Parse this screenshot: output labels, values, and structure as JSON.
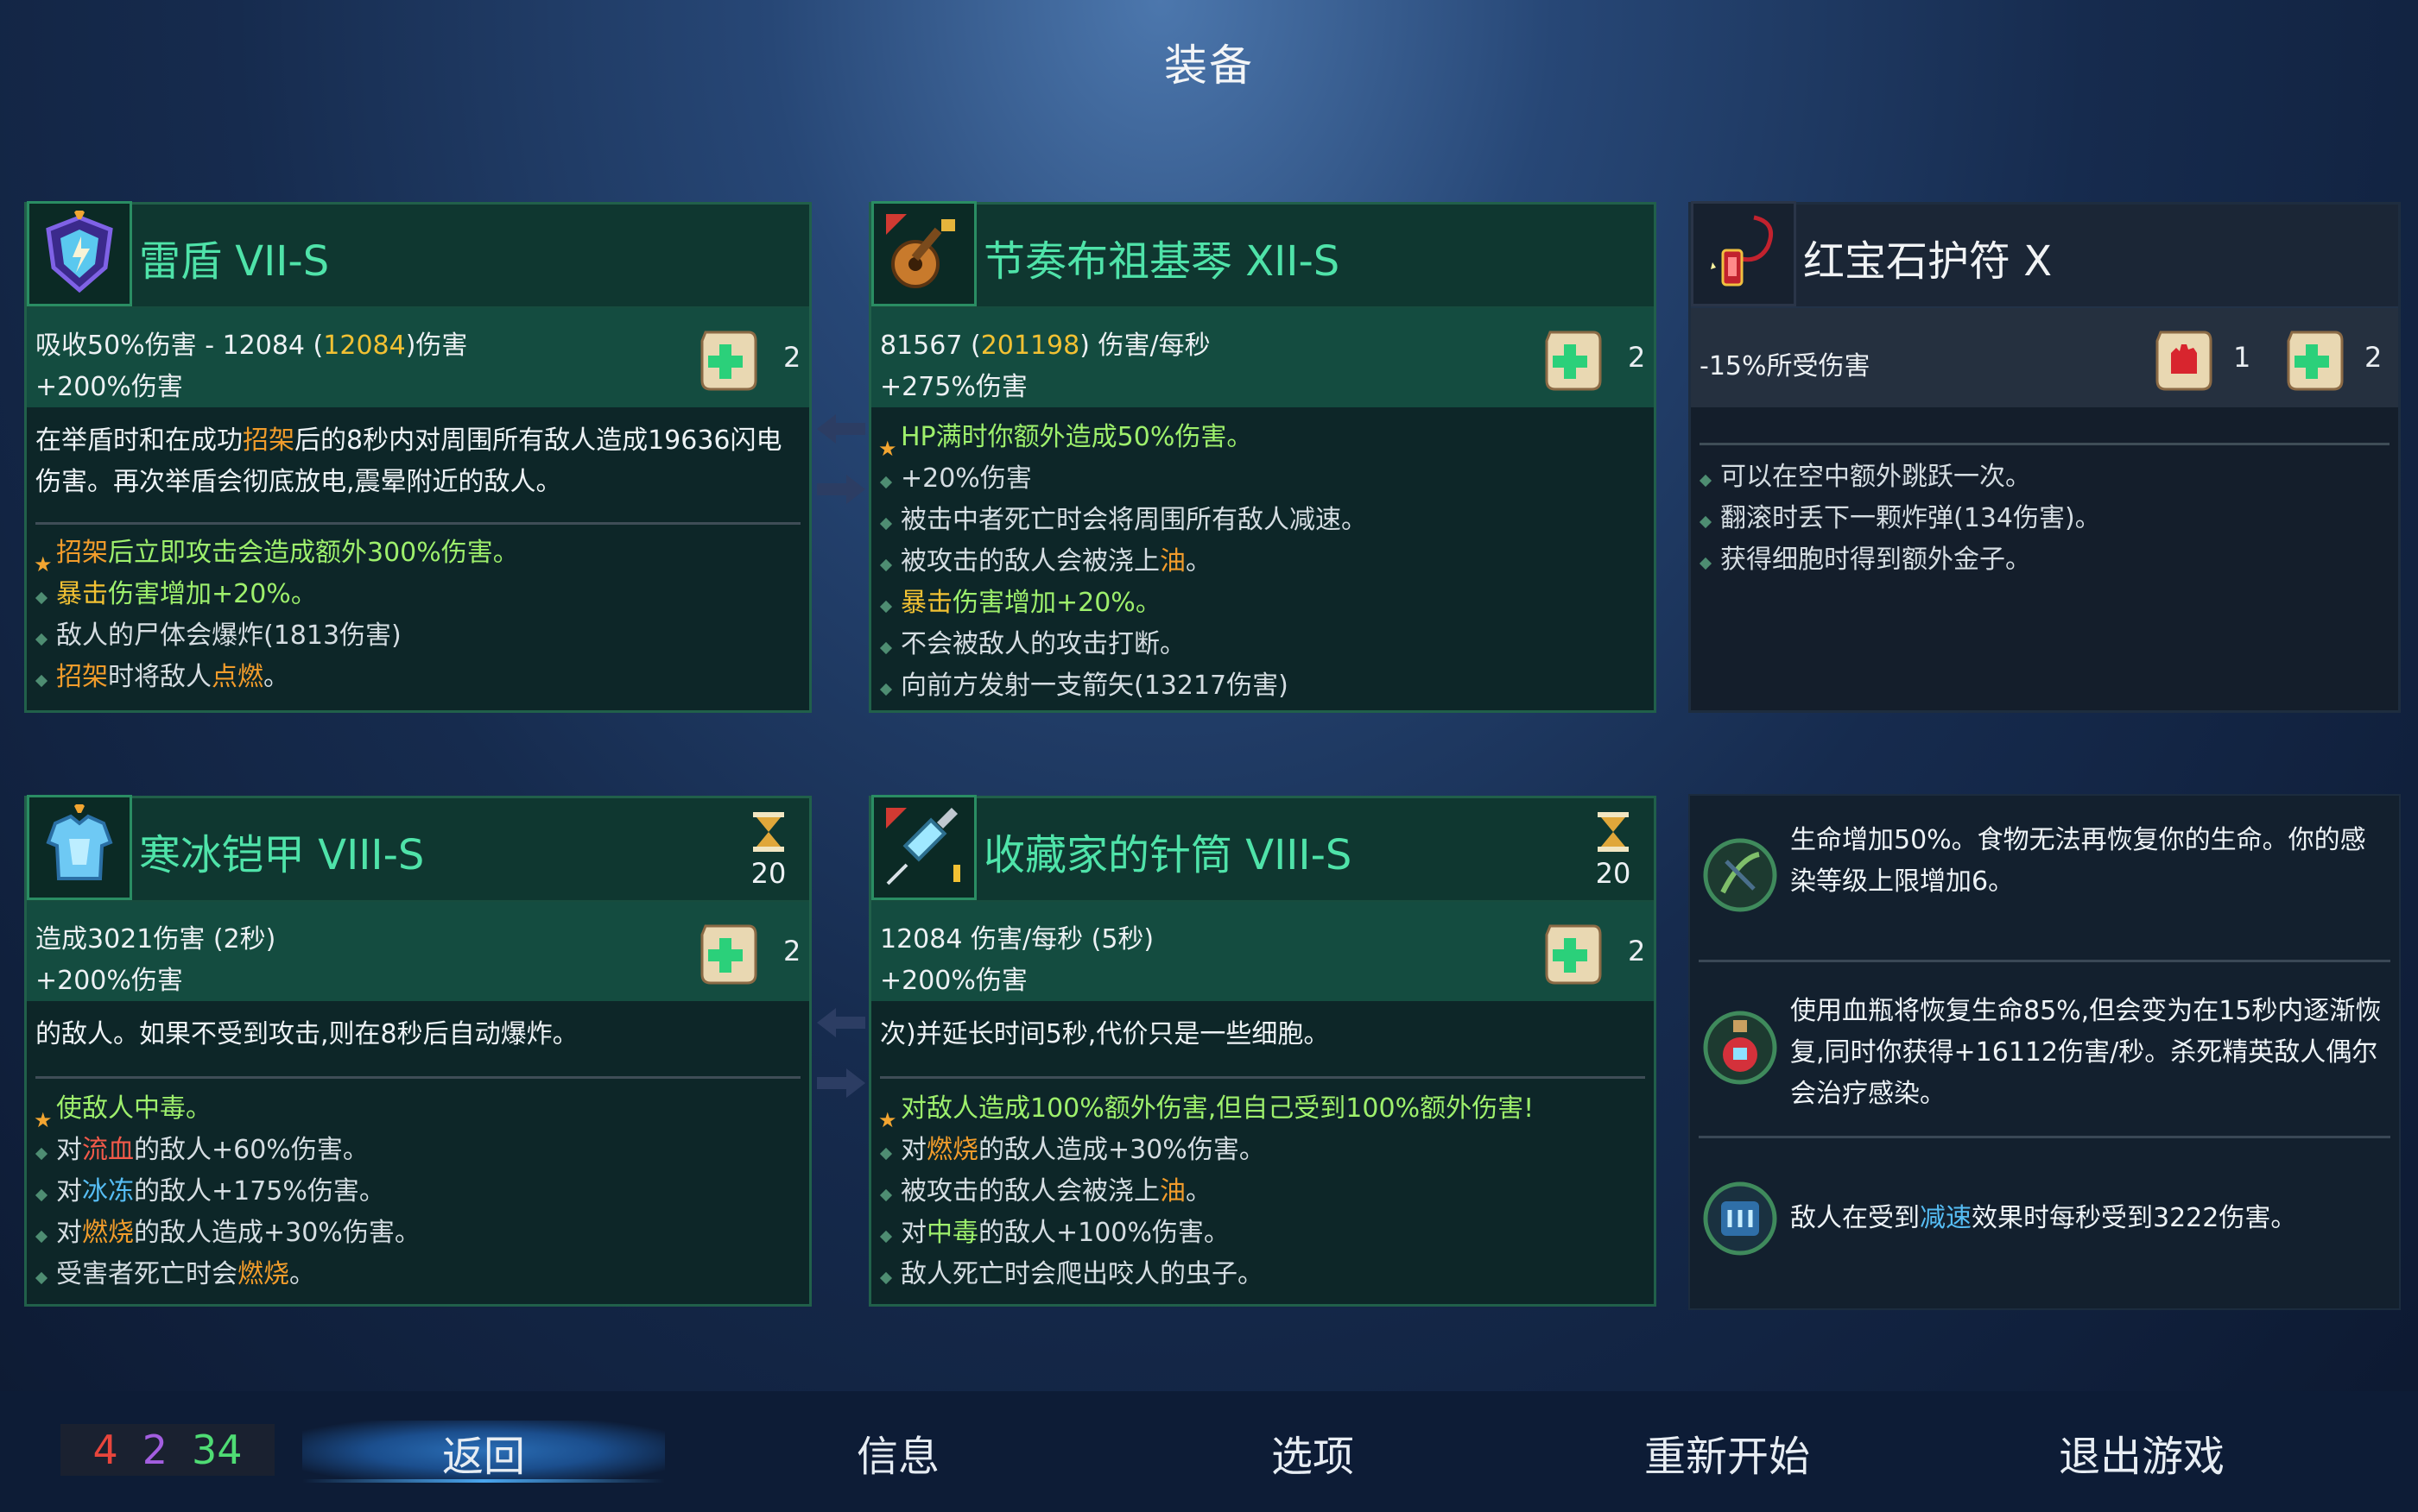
{
  "title": "装备",
  "cards": {
    "c1": {
      "name": "雷盾 VII-S",
      "stat1": {
        "a": "吸收50%伤害 - 12084 (",
        "b": "12084",
        "c": ")伤害"
      },
      "stat2": "+200%伤害",
      "scroll_count": "2",
      "desc": [
        {
          "t": "在举盾时和在成功",
          "c": ""
        },
        {
          "t": "招架",
          "c": "orange"
        },
        {
          "t": "后的8秒内对周围所有敌人造成19636闪电伤害。再次举盾会彻底放电,震晕附近的敌人。",
          "c": ""
        }
      ],
      "affixes": [
        {
          "bullet": "star",
          "parts": [
            {
              "t": "招架",
              "c": "orange"
            },
            {
              "t": "后立即攻击会造成额外300%伤害。",
              "c": "green"
            }
          ]
        },
        {
          "bullet": "dot",
          "parts": [
            {
              "t": "暴击",
              "c": "yellow"
            },
            {
              "t": "伤害增加+20%。",
              "c": "green"
            }
          ]
        },
        {
          "bullet": "dot",
          "parts": [
            {
              "t": "敌人的尸体会爆炸(1813伤害)",
              "c": ""
            }
          ]
        },
        {
          "bullet": "dot",
          "parts": [
            {
              "t": "招架",
              "c": "orange"
            },
            {
              "t": "时将敌人",
              "c": ""
            },
            {
              "t": "点燃",
              "c": "orange"
            },
            {
              "t": "。",
              "c": ""
            }
          ]
        }
      ]
    },
    "c2": {
      "name": "节奏布祖基琴 XII-S",
      "stat1": {
        "a": "81567 (",
        "b": "201198",
        "c": ") 伤害/每秒"
      },
      "stat2": "+275%伤害",
      "scroll_count": "2",
      "affixes": [
        {
          "bullet": "star",
          "parts": [
            {
              "t": "HP满时你额外造成50%伤害。",
              "c": "green"
            }
          ]
        },
        {
          "bullet": "dot",
          "parts": [
            {
              "t": "+20%伤害",
              "c": ""
            }
          ]
        },
        {
          "bullet": "dot",
          "parts": [
            {
              "t": "被击中者死亡时会将周围所有敌人减速。",
              "c": ""
            }
          ]
        },
        {
          "bullet": "dot",
          "parts": [
            {
              "t": "被攻击的敌人会被浇上",
              "c": ""
            },
            {
              "t": "油",
              "c": "orange"
            },
            {
              "t": "。",
              "c": ""
            }
          ]
        },
        {
          "bullet": "dot",
          "parts": [
            {
              "t": "暴击",
              "c": "yellow"
            },
            {
              "t": "伤害增加+20%。",
              "c": "green"
            }
          ]
        },
        {
          "bullet": "dot",
          "parts": [
            {
              "t": "不会被敌人的攻击打断。",
              "c": ""
            }
          ]
        },
        {
          "bullet": "dot",
          "parts": [
            {
              "t": "向前方发射一支箭矢(13217伤害)",
              "c": ""
            }
          ]
        }
      ]
    },
    "c3": {
      "name": "红宝石护符 X",
      "stat1": "-15%所受伤害",
      "scroll1_count": "1",
      "scroll2_count": "2",
      "affixes": [
        {
          "bullet": "dot",
          "parts": [
            {
              "t": "可以在空中额外跳跃一次。",
              "c": ""
            }
          ]
        },
        {
          "bullet": "dot",
          "parts": [
            {
              "t": "翻滚时丢下一颗炸弹(134伤害)。",
              "c": ""
            }
          ]
        },
        {
          "bullet": "dot",
          "parts": [
            {
              "t": "获得细胞时得到额外金子。",
              "c": ""
            }
          ]
        }
      ]
    },
    "c4": {
      "name": "寒冰铠甲 VIII-S",
      "cooldown": "20",
      "stat1": "造成3021伤害 (2秒)",
      "stat2": "+200%伤害",
      "scroll_count": "2",
      "desc": [
        {
          "t": "的敌人。如果不受到攻击,则在8秒后自动爆炸。",
          "c": ""
        }
      ],
      "affixes": [
        {
          "bullet": "star",
          "parts": [
            {
              "t": "使敌人",
              "c": "green"
            },
            {
              "t": "中毒",
              "c": "green"
            },
            {
              "t": "。",
              "c": "green"
            }
          ]
        },
        {
          "bullet": "dot",
          "parts": [
            {
              "t": "对",
              "c": ""
            },
            {
              "t": "流血",
              "c": "red"
            },
            {
              "t": "的敌人+60%伤害。",
              "c": ""
            }
          ]
        },
        {
          "bullet": "dot",
          "parts": [
            {
              "t": "对",
              "c": ""
            },
            {
              "t": "冰冻",
              "c": "blue"
            },
            {
              "t": "的敌人+175%伤害。",
              "c": ""
            }
          ]
        },
        {
          "bullet": "dot",
          "parts": [
            {
              "t": "对",
              "c": ""
            },
            {
              "t": "燃烧",
              "c": "orange"
            },
            {
              "t": "的敌人造成+30%伤害。",
              "c": ""
            }
          ]
        },
        {
          "bullet": "dot",
          "parts": [
            {
              "t": "受害者死亡时会",
              "c": ""
            },
            {
              "t": "燃烧",
              "c": "orange"
            },
            {
              "t": "。",
              "c": ""
            }
          ]
        }
      ]
    },
    "c5": {
      "name": "收藏家的针筒 VIII-S",
      "cooldown": "20",
      "stat1": "12084 伤害/每秒 (5秒)",
      "stat2": "+200%伤害",
      "scroll_count": "2",
      "desc": [
        {
          "t": "次)并延长时间5秒,代价只是一些细胞。",
          "c": ""
        }
      ],
      "affixes": [
        {
          "bullet": "star2",
          "parts": [
            {
              "t": "对敌人造成100%额外伤害,但自己受到100%额外伤害!",
              "c": "green"
            }
          ]
        },
        {
          "bullet": "dot",
          "parts": [
            {
              "t": "对",
              "c": ""
            },
            {
              "t": "燃烧",
              "c": "orange"
            },
            {
              "t": "的敌人造成+30%伤害。",
              "c": ""
            }
          ]
        },
        {
          "bullet": "dot",
          "parts": [
            {
              "t": "被攻击的敌人会被浇上",
              "c": ""
            },
            {
              "t": "油",
              "c": "orange"
            },
            {
              "t": "。",
              "c": ""
            }
          ]
        },
        {
          "bullet": "dot",
          "parts": [
            {
              "t": "对",
              "c": ""
            },
            {
              "t": "中毒",
              "c": "green"
            },
            {
              "t": "的敌人+100%伤害。",
              "c": ""
            }
          ]
        },
        {
          "bullet": "dot",
          "parts": [
            {
              "t": "敌人死亡时会爬出咬人的虫子。",
              "c": ""
            }
          ]
        }
      ]
    }
  },
  "mutations": [
    {
      "icon": "vine-rune-icon",
      "parts": [
        {
          "t": "生命增加50%。食物无法再恢复你的生命。你的感染等级上限增加6。",
          "c": ""
        }
      ]
    },
    {
      "icon": "blood-flask-icon",
      "parts": [
        {
          "t": "使用血瓶将恢复生命85%,但会变为在15秒内逐渐恢复,同时你获得+16112伤害/秒。杀死精英敌人偶尔会治疗感染。",
          "c": ""
        }
      ]
    },
    {
      "icon": "frost-rune-icon",
      "parts": [
        {
          "t": "敌人在受到",
          "c": ""
        },
        {
          "t": "减速",
          "c": "blue"
        },
        {
          "t": "效果时每秒受到3222伤害。",
          "c": ""
        }
      ]
    }
  ],
  "stats": {
    "brutality": "4",
    "tactics": "2",
    "survival": "34"
  },
  "stat_colors": {
    "brutality": "#e8453c",
    "tactics": "#a35ee0",
    "survival": "#4fdc74"
  },
  "menu": {
    "back": "返回",
    "info": "信息",
    "options": "选项",
    "restart": "重新开始",
    "quit": "退出游戏"
  }
}
